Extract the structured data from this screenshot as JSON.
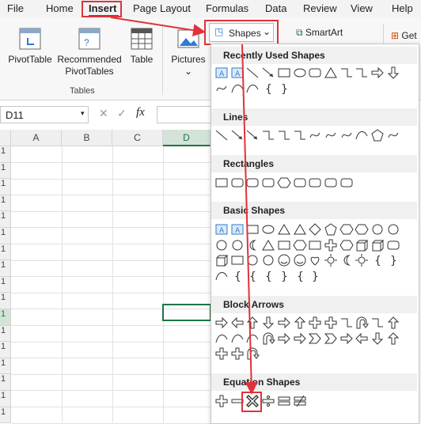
{
  "tabs": [
    "File",
    "Home",
    "Insert",
    "Page Layout",
    "Formulas",
    "Data",
    "Review",
    "View",
    "Help"
  ],
  "ribbon": {
    "pivottable": "PivotTable",
    "recommended_1": "Recommended",
    "recommended_2": "PivotTables",
    "table": "Table",
    "pictures": "Pictures",
    "shapes": "Shapes",
    "smartart": "SmartArt",
    "get": "Get",
    "tables_group": "Tables"
  },
  "formula_bar": {
    "namebox": "D11",
    "fx": "fx"
  },
  "columns": [
    "A",
    "B",
    "C",
    "D"
  ],
  "rows": [
    "1",
    "1",
    "1",
    "1",
    "1",
    "1",
    "1",
    "1",
    "1",
    "1",
    "1",
    "1",
    "1",
    "1",
    "1",
    "1",
    "1"
  ],
  "shapes_menu": {
    "recent": "Recently Used Shapes",
    "lines": "Lines",
    "rectangles": "Rectangles",
    "basic": "Basic Shapes",
    "block_arrows": "Block Arrows",
    "equation": "Equation Shapes"
  },
  "colors": {
    "highlight": "#e0323a",
    "selection": "#217346"
  }
}
